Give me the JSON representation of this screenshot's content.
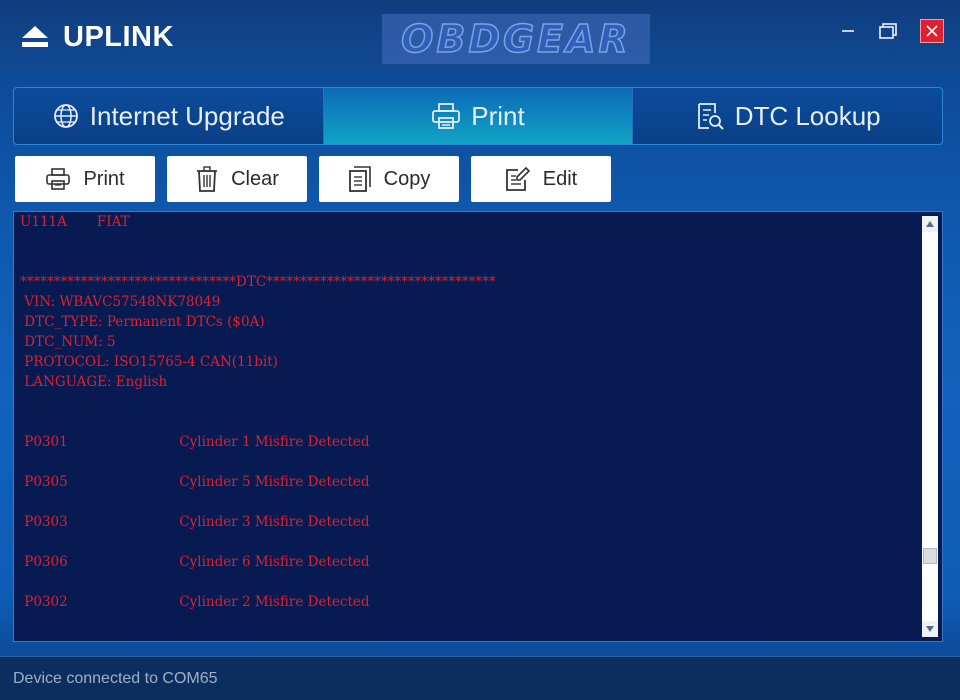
{
  "app": {
    "title": "UPLINK",
    "watermark": "OBDGEAR"
  },
  "window_controls": {
    "minimize_icon": "minimize-icon",
    "maximize_icon": "maximize-icon",
    "close_icon": "close-icon"
  },
  "tabs": [
    {
      "label": "Internet Upgrade",
      "icon": "globe-icon",
      "active": false
    },
    {
      "label": "Print",
      "icon": "printer-icon",
      "active": true
    },
    {
      "label": "DTC Lookup",
      "icon": "document-search-icon",
      "active": false
    }
  ],
  "toolbar": {
    "print_label": "Print",
    "clear_label": "Clear",
    "copy_label": "Copy",
    "edit_label": "Edit"
  },
  "console": {
    "lines": [
      "U111A       FIAT",
      "",
      "",
      "********************************DTC**********************************",
      " VIN: WBAVC57548NK78049",
      " DTC_TYPE: Permanent DTCs ($0A)",
      " DTC_NUM: 5",
      " PROTOCOL: ISO15765-4 CAN(11bit)",
      " LANGUAGE: English",
      "",
      "",
      " P0301                          Cylinder 1 Misfire Detected",
      "",
      " P0305                          Cylinder 5 Misfire Detected",
      "",
      " P0303                          Cylinder 3 Misfire Detected",
      "",
      " P0306                          Cylinder 6 Misfire Detected",
      "",
      " P0302                          Cylinder 2 Misfire Detected"
    ]
  },
  "status": {
    "text": "Device connected to COM65"
  },
  "colors": {
    "console_bg": "#071a52",
    "console_text": "#e0202a",
    "active_tab": "#11a4c6",
    "close_button": "#e02030"
  }
}
